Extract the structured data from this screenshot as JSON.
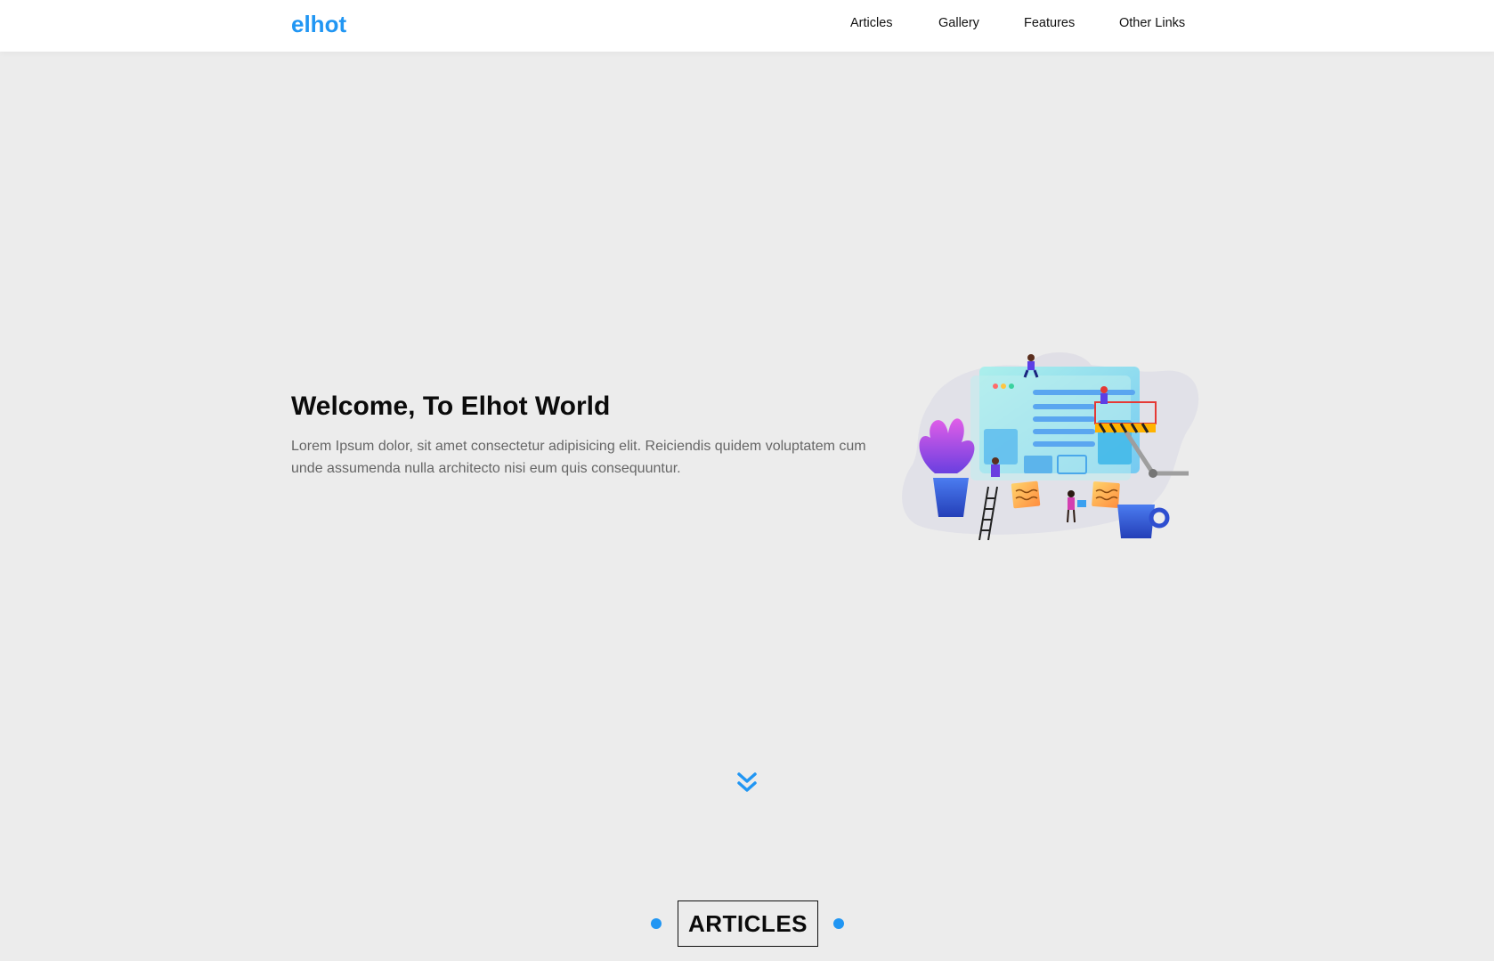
{
  "header": {
    "logo": "elhot",
    "nav": [
      {
        "label": "Articles"
      },
      {
        "label": "Gallery"
      },
      {
        "label": "Features"
      },
      {
        "label": "Other Links"
      }
    ]
  },
  "hero": {
    "title": "Welcome, To Elhot World",
    "text": "Lorem Ipsum dolor, sit amet consectetur adipisicing elit. Reiciendis quidem voluptatem cum unde assumenda nulla architecto nisi eum quis consequuntur.",
    "illustration": "website-construction-illustration"
  },
  "scroll": {
    "icon": "double-chevron-down-icon"
  },
  "section": {
    "title": "ARTICLES"
  },
  "colors": {
    "accent": "#2196f3",
    "background": "#ececec",
    "header_bg": "#ffffff",
    "text_dark": "#0b0b0b",
    "text_muted": "#666666"
  }
}
